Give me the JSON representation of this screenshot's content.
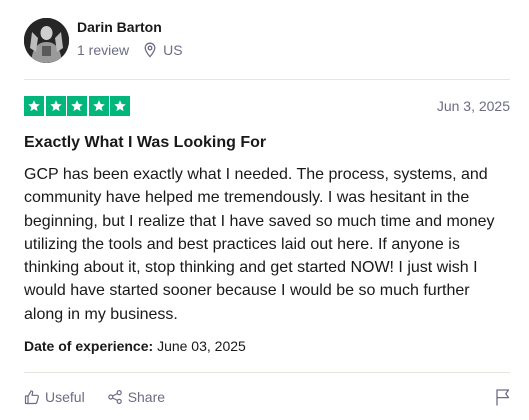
{
  "reviewer": {
    "name": "Darin Barton",
    "review_count": "1 review",
    "country": "US",
    "avatar_icon": "profile-photo"
  },
  "review": {
    "rating": 5,
    "rating_max": 5,
    "star_color": "#00b67a",
    "date": "Jun 3, 2025",
    "title": "Exactly What I Was Looking For",
    "body": "GCP has been exactly what I needed. The process, systems, and community have helped me tremendously. I was hesitant in the beginning, but I realize that I have saved so much time and money utilizing the tools and best practices laid out here. If anyone is thinking about it, stop thinking and get started NOW! I just wish I would have started sooner because I would be so much further along in my business.",
    "experience_label": "Date of experience:",
    "experience_date": "June 03, 2025"
  },
  "actions": {
    "useful_label": "Useful",
    "share_label": "Share",
    "useful_icon": "thumbs-up-icon",
    "share_icon": "share-icon",
    "report_icon": "flag-icon"
  }
}
